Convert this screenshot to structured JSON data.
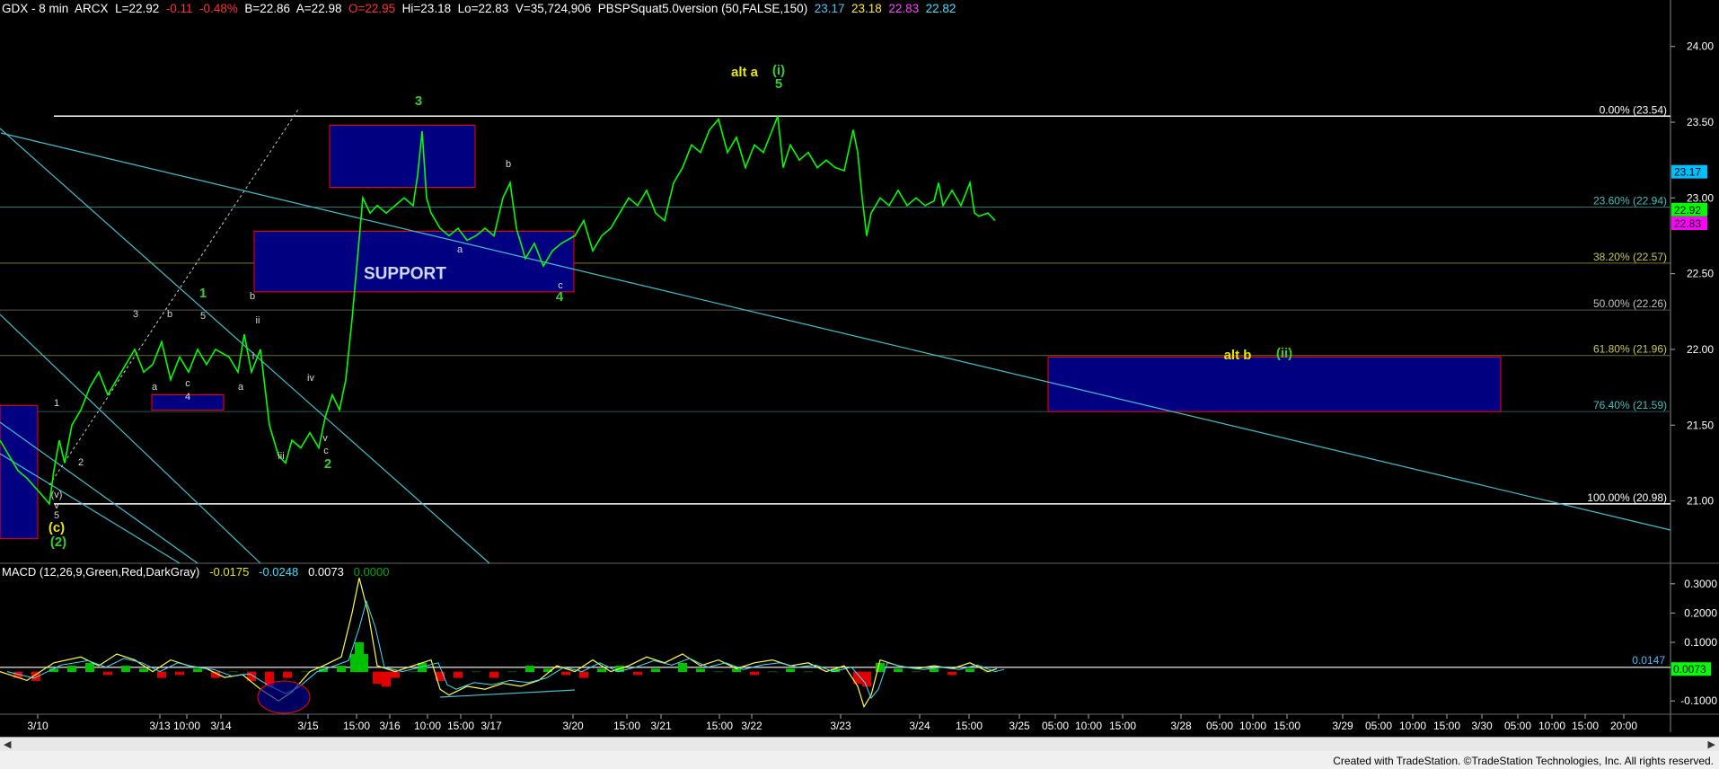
{
  "header": {
    "symbol": "GDX - 8 min",
    "exchange": "ARCX",
    "last": "L=22.92",
    "change": "-0.11",
    "pct": "-0.48%",
    "bid": "B=22.86",
    "ask": "A=22.98",
    "open": "O=22.95",
    "high": "Hi=23.18",
    "low": "Lo=22.83",
    "volume": "V=35,724,906",
    "indicator": "PBSPSquat5.0version (50,FALSE,150)",
    "ind_vals": [
      "23.17",
      "23.18",
      "22.83",
      "22.82"
    ],
    "ind_colors": [
      "#4fc3f7",
      "#ffeb3b",
      "#ff40ff",
      "#40e0ff"
    ]
  },
  "macd_header": {
    "name": "MACD (12,26,9,Green,Red,DarkGray)",
    "v1": "-0.0175",
    "v2": "-0.0248",
    "v3": "0.0073",
    "v4": "0.0000"
  },
  "footer": "Created with TradeStation. ©TradeStation Technologies, Inc. All rights reserved.",
  "colors": {
    "up": "#00ff00",
    "wave_green": "#33cc33",
    "box": "#000080",
    "box_border": "#ff0000",
    "trend": "#40c0d0",
    "fib_line": "#606030",
    "label_yellow": "#e8e800"
  },
  "chart_data": [
    {
      "type": "line",
      "title": "",
      "series": [
        {
          "name": "",
          "values": []
        }
      ],
      "ylim": [
        20.6,
        24.2
      ],
      "y_ticks": [
        "24.00",
        "23.50",
        "23.00",
        "22.50",
        "22.00",
        "21.50",
        "21.00"
      ],
      "price_tags": [
        {
          "label": "23.17",
          "bg": "#00bfff",
          "fg": "#000"
        },
        {
          "label": "22.92",
          "bg": "#00ff00",
          "fg": "#000"
        },
        {
          "label": "22.83",
          "bg": "#ff00ff",
          "fg": "#000"
        }
      ],
      "x_ticks": [
        "3/10",
        "3/13",
        "10:00",
        "3/14",
        "3/15",
        "15:00",
        "3/16",
        "10:00",
        "15:00",
        "3/17",
        "3/20",
        "15:00",
        "3/21",
        "15:00",
        "3/22",
        "3/23",
        "3/24",
        "15:00",
        "3/25",
        "05:00",
        "10:00",
        "15:00",
        "3/28",
        "05:00",
        "10:00",
        "15:00",
        "3/29",
        "05:00",
        "10:00",
        "15:00",
        "3/30",
        "05:00",
        "10:00",
        "15:00",
        "20:00"
      ],
      "fib_levels": [
        {
          "label": "0.00% (23.54)",
          "value": 23.54
        },
        {
          "label": "23.60% (22.94)",
          "value": 22.94
        },
        {
          "label": "38.20% (22.57)",
          "value": 22.57
        },
        {
          "label": "50.00% (22.26)",
          "value": 22.26
        },
        {
          "label": "61.80% (21.96)",
          "value": 21.96
        },
        {
          "label": "76.40% (21.59)",
          "value": 21.59
        },
        {
          "label": "100.00% (20.98)",
          "value": 20.98
        }
      ],
      "support_label": "SUPPORT",
      "wave_labels": [
        {
          "t": "(2)",
          "c": "green"
        },
        {
          "t": "(c)",
          "c": "yellow"
        },
        {
          "t": "5",
          "c": "white"
        },
        {
          "t": "v",
          "c": "white"
        },
        {
          "t": "(v)",
          "c": "white"
        },
        {
          "t": "1",
          "c": "white"
        },
        {
          "t": "2",
          "c": "white"
        },
        {
          "t": "3",
          "c": "white"
        },
        {
          "t": "a",
          "c": "white"
        },
        {
          "t": "b",
          "c": "white"
        },
        {
          "t": "c",
          "c": "white"
        },
        {
          "t": "4",
          "c": "white"
        },
        {
          "t": "5",
          "c": "white"
        },
        {
          "t": "1",
          "c": "green"
        },
        {
          "t": "b",
          "c": "white"
        },
        {
          "t": "ii",
          "c": "white"
        },
        {
          "t": "i",
          "c": "white"
        },
        {
          "t": "a",
          "c": "white"
        },
        {
          "t": "iii",
          "c": "white"
        },
        {
          "t": "iv",
          "c": "white"
        },
        {
          "t": "v",
          "c": "white"
        },
        {
          "t": "c",
          "c": "white"
        },
        {
          "t": "2",
          "c": "green"
        },
        {
          "t": "3",
          "c": "green"
        },
        {
          "t": "a",
          "c": "white"
        },
        {
          "t": "b",
          "c": "white"
        },
        {
          "t": "c",
          "c": "white"
        },
        {
          "t": "4",
          "c": "green"
        },
        {
          "t": "alt a",
          "c": "yellow"
        },
        {
          "t": "(i)",
          "c": "green"
        },
        {
          "t": "5",
          "c": "green"
        },
        {
          "t": "alt b",
          "c": "yellow"
        },
        {
          "t": "(ii)",
          "c": "green"
        }
      ]
    },
    {
      "type": "line",
      "title": "",
      "ylim": [
        -0.13,
        0.33
      ],
      "y_ticks": [
        "0.3000",
        "0.2000",
        "0.1000",
        "-0.1000"
      ],
      "level_label": "0.0147",
      "price_tag": {
        "label": "0.0073",
        "bg": "#00ff00"
      }
    }
  ]
}
